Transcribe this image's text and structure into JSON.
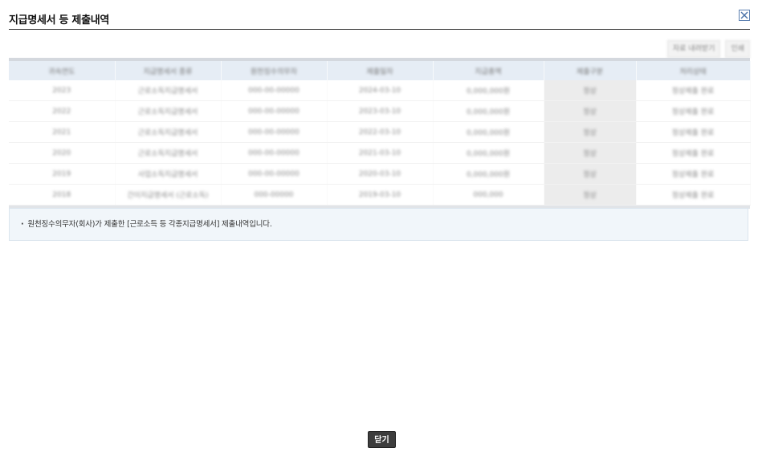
{
  "popup": {
    "title": "지급명세서 등 제출내역",
    "close_icon": "close-x-icon",
    "close_button_label": "닫기"
  },
  "toolbar": {
    "btn1_label": "자료 내려받기",
    "btn2_label": "인쇄"
  },
  "grid": {
    "headers": [
      "귀속연도",
      "지급명세서 종류",
      "원천징수의무자",
      "제출일자",
      "지급총액",
      "제출구분",
      "처리상태"
    ],
    "rows": [
      [
        "2023",
        "근로소득지급명세서",
        "000-00-00000",
        "2024-03-10",
        "0,000,000원",
        "정상",
        "정상제출 완료"
      ],
      [
        "2022",
        "근로소득지급명세서",
        "000-00-00000",
        "2023-03-10",
        "0,000,000원",
        "정상",
        "정상제출 완료"
      ],
      [
        "2021",
        "근로소득지급명세서",
        "000-00-00000",
        "2022-03-10",
        "0,000,000원",
        "정상",
        "정상제출 완료"
      ],
      [
        "2020",
        "근로소득지급명세서",
        "000-00-00000",
        "2021-03-10",
        "0,000,000원",
        "정상",
        "정상제출 완료"
      ],
      [
        "2019",
        "사업소득지급명세서",
        "000-00-00000",
        "2020-03-10",
        "0,000,000원",
        "정상",
        "정상제출 완료"
      ],
      [
        "2018",
        "간이지급명세서 (근로소득)",
        "000-00000",
        "2019-03-10",
        "000,000",
        "정상",
        "정상제출 완료"
      ]
    ]
  },
  "notice": {
    "bullet": "·",
    "text": "원천징수의무자(회사)가 제출한 [근로소득 등 각종지급명세서] 제출내역입니다."
  }
}
